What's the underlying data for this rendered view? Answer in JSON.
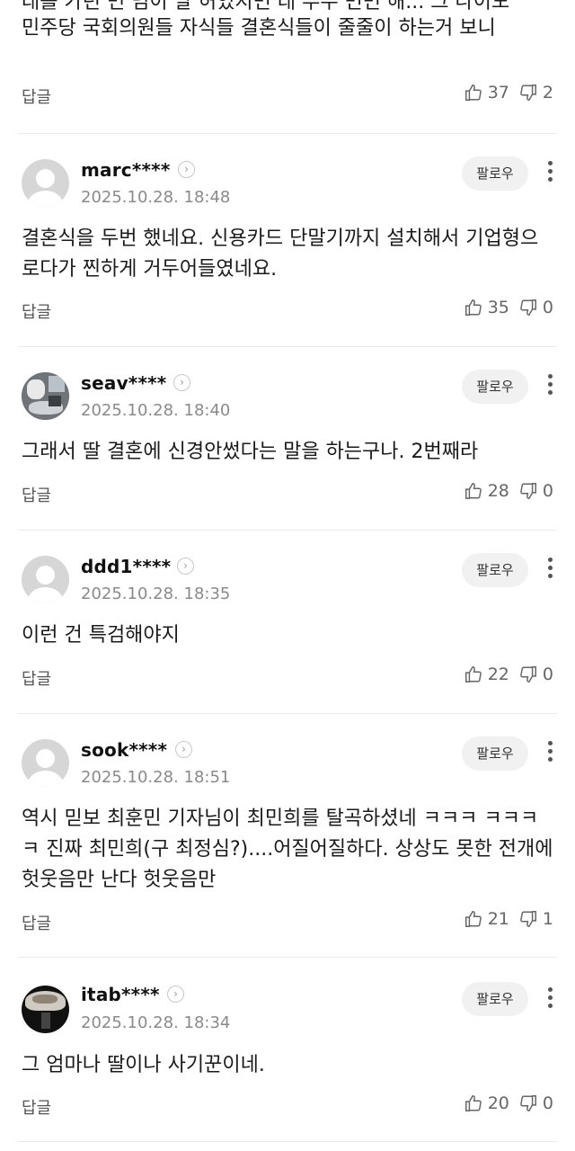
{
  "partial_comment": {
    "text_cut": "대를 가던 면 님이 발 허었지면 대 무우 면면 해... 그 나이도",
    "text": "민주당 국회의원들 자식들 결혼식들이 줄줄이 하는거 보니",
    "reply_label": "답글",
    "likes": "37",
    "dislikes": "2"
  },
  "comments": [
    {
      "user": "marc****",
      "date": "2025.10.28. 18:48",
      "follow_label": "팔로우",
      "text": "결혼식을 두번 했네요. 신용카드 단말기까지 설치해서 기업형으로다가 찐하게 거두어들였네요.",
      "reply_label": "답글",
      "likes": "35",
      "dislikes": "0",
      "avatar": "default-avatar"
    },
    {
      "user": "seav****",
      "date": "2025.10.28. 18:40",
      "follow_label": "팔로우",
      "text": "그래서 딸 결혼에 신경안썼다는 말을 하는구나. 2번째라",
      "reply_label": "답글",
      "likes": "28",
      "dislikes": "0",
      "avatar": "photo-avatar"
    },
    {
      "user": "ddd1****",
      "date": "2025.10.28. 18:35",
      "follow_label": "팔로우",
      "text": "이런 건 특검해야지",
      "reply_label": "답글",
      "likes": "22",
      "dislikes": "0",
      "avatar": "default-avatar"
    },
    {
      "user": "sook****",
      "date": "2025.10.28. 18:51",
      "follow_label": "팔로우",
      "text": "역시 믿보 최훈민 기자님이 최민희를 탈곡하셨네 ㅋㅋㅋ ㅋㅋㅋㅋ 진짜 최민희(구 최정심?)....어질어질하다. 상상도 못한 전개에 헛웃음만 난다 헛웃음만",
      "reply_label": "답글",
      "likes": "21",
      "dislikes": "1",
      "avatar": "default-avatar"
    },
    {
      "user": "itab****",
      "date": "2025.10.28. 18:34",
      "follow_label": "팔로우",
      "text": "그 엄마나 딸이나 사기꾼이네.",
      "reply_label": "답글",
      "likes": "20",
      "dislikes": "0",
      "avatar": "photo-avatar"
    }
  ],
  "colors": {
    "text": "#1a1a1a",
    "muted": "#8a8a8a",
    "follow_bg": "#f1f1f1",
    "divider": "#ececec"
  }
}
